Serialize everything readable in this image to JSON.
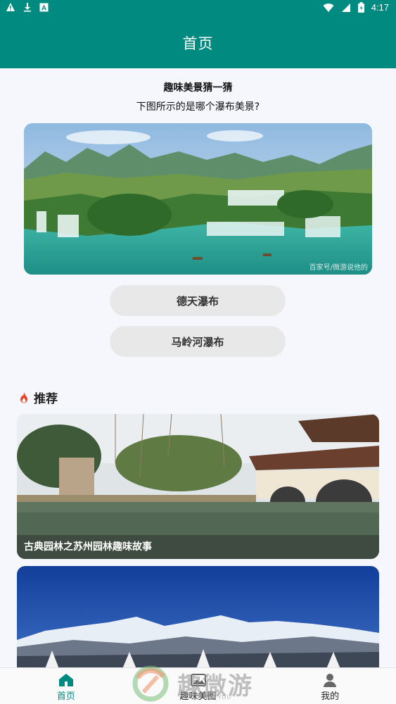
{
  "status_bar": {
    "time": "4:17",
    "left_icons": [
      "warning-icon",
      "download-icon",
      "a-box-icon"
    ],
    "right_icons": [
      "wifi-icon",
      "signal-icon",
      "battery-icon"
    ]
  },
  "app_bar": {
    "title": "首页",
    "color": "#008a80"
  },
  "quiz": {
    "heading": "趣味美景猜一猜",
    "question": "下图所示的是哪个瀑布美景?",
    "image_watermark": "百家号/微游说他的",
    "options": [
      "德天瀑布",
      "马岭河瀑布"
    ]
  },
  "recommend": {
    "title": "推荐",
    "icon": "fire-icon",
    "cards": [
      {
        "caption": "古典园林之苏州园林趣味故事"
      },
      {
        "caption": ""
      }
    ]
  },
  "bottom_nav": {
    "items": [
      {
        "label": "首页",
        "icon": "home-icon",
        "active": true
      },
      {
        "label": "趣味美图",
        "icon": "image-icon",
        "active": false
      },
      {
        "label": "我的",
        "icon": "person-icon",
        "active": false
      }
    ]
  },
  "logo_watermark": {
    "brand": "趣微游",
    "sub": "QU WEI YOU"
  }
}
